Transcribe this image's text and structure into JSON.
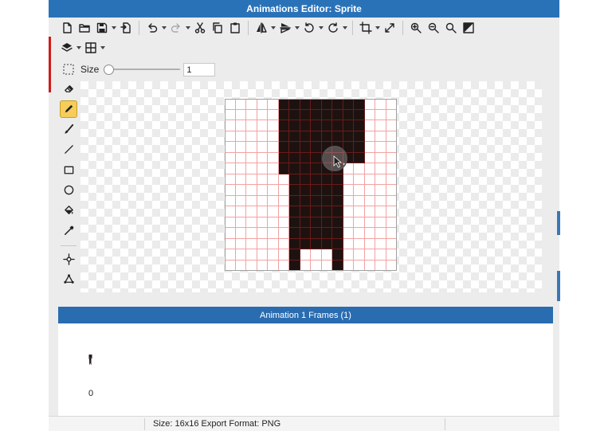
{
  "window": {
    "title": "Animations Editor: Sprite"
  },
  "toolbar": {
    "row1": [
      {
        "icon": "new-file-icon"
      },
      {
        "icon": "open-folder-icon"
      },
      {
        "icon": "save-icon",
        "dropdown": true
      },
      {
        "icon": "export-icon"
      },
      {
        "sep": true
      },
      {
        "icon": "undo-icon",
        "dropdown": true
      },
      {
        "icon": "redo-icon",
        "dropdown": true
      },
      {
        "icon": "cut-icon"
      },
      {
        "icon": "copy-icon"
      },
      {
        "icon": "paste-icon"
      },
      {
        "sep": true
      },
      {
        "icon": "flip-horizontal-icon",
        "dropdown": true
      },
      {
        "icon": "flip-vertical-icon",
        "dropdown": true
      },
      {
        "icon": "rotate-ccw-icon",
        "dropdown": true
      },
      {
        "icon": "rotate-cw-icon",
        "dropdown": true
      },
      {
        "sep": true
      },
      {
        "icon": "crop-icon",
        "dropdown": true
      },
      {
        "icon": "resize-icon"
      },
      {
        "sep": true
      },
      {
        "icon": "zoom-in-icon"
      },
      {
        "icon": "zoom-out-icon"
      },
      {
        "icon": "zoom-fit-icon"
      },
      {
        "icon": "toggle-transparency-icon"
      }
    ],
    "row2": [
      {
        "icon": "layers-icon",
        "dropdown": true
      },
      {
        "icon": "grid-icon",
        "dropdown": true
      }
    ]
  },
  "brush": {
    "size_label": "Size",
    "size_value": "1",
    "size_fraction": 0.0
  },
  "tools": [
    {
      "icon": "eraser-icon",
      "active": false
    },
    {
      "icon": "pencil-icon",
      "active": true
    },
    {
      "icon": "brush-icon",
      "active": false
    },
    {
      "icon": "line-icon",
      "active": false
    },
    {
      "icon": "rectangle-icon",
      "active": false
    },
    {
      "icon": "ellipse-icon",
      "active": false
    },
    {
      "icon": "fill-bucket-icon",
      "active": false
    },
    {
      "icon": "color-picker-icon",
      "active": false
    },
    {
      "sep": true
    },
    {
      "icon": "move-origin-icon",
      "active": false
    },
    {
      "icon": "transform-points-icon",
      "active": false
    }
  ],
  "sprite": {
    "width": 16,
    "height": 16,
    "rows": [
      "0000011111111000",
      "0000011111111000",
      "0000011111111000",
      "0000011111111000",
      "0000011111111000",
      "0000011111111000",
      "0000011111100000",
      "0000001111100000",
      "0000001111100000",
      "0000001111100000",
      "0000001111100000",
      "0000001111100000",
      "0000001111100000",
      "0000001111100000",
      "0000001000100000",
      "0000001000100000"
    ]
  },
  "frames": {
    "header": "Animation 1 Frames (1)",
    "items": [
      {
        "index": "0"
      }
    ]
  },
  "status": {
    "text": "Size: 16x16   Export Format: PNG"
  }
}
